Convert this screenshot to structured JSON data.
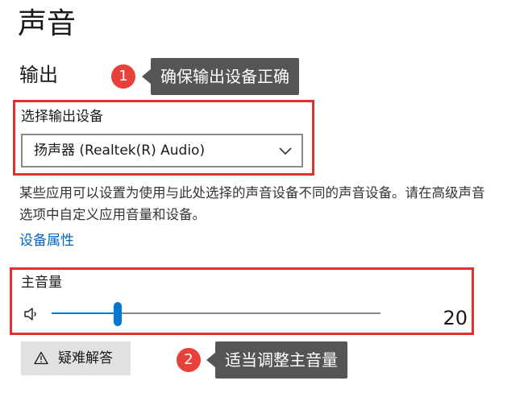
{
  "page": {
    "title": "声音"
  },
  "output": {
    "heading": "输出",
    "device_label": "选择输出设备",
    "device_selected": "扬声器 (Realtek(R) Audio)",
    "description": "某些应用可以设置为使用与此处选择的声音设备不同的声音设备。请在高级声音选项中自定义应用音量和设备。",
    "properties_link": "设备属性",
    "volume_label": "主音量",
    "volume_value": "20",
    "volume_fraction": 0.2,
    "speaker_icon": "speaker-icon",
    "chevron_icon": "chevron-down-icon"
  },
  "troubleshoot": {
    "label": "疑难解答",
    "icon": "warning-icon"
  },
  "annotations": [
    {
      "number": "1",
      "text": "确保输出设备正确"
    },
    {
      "number": "2",
      "text": "适当调整主音量"
    }
  ],
  "colors": {
    "accent": "#0078d4",
    "link": "#0067c0",
    "annotation_red": "#e8403a",
    "highlight_border": "#e03030",
    "callout_bg": "#555555"
  }
}
